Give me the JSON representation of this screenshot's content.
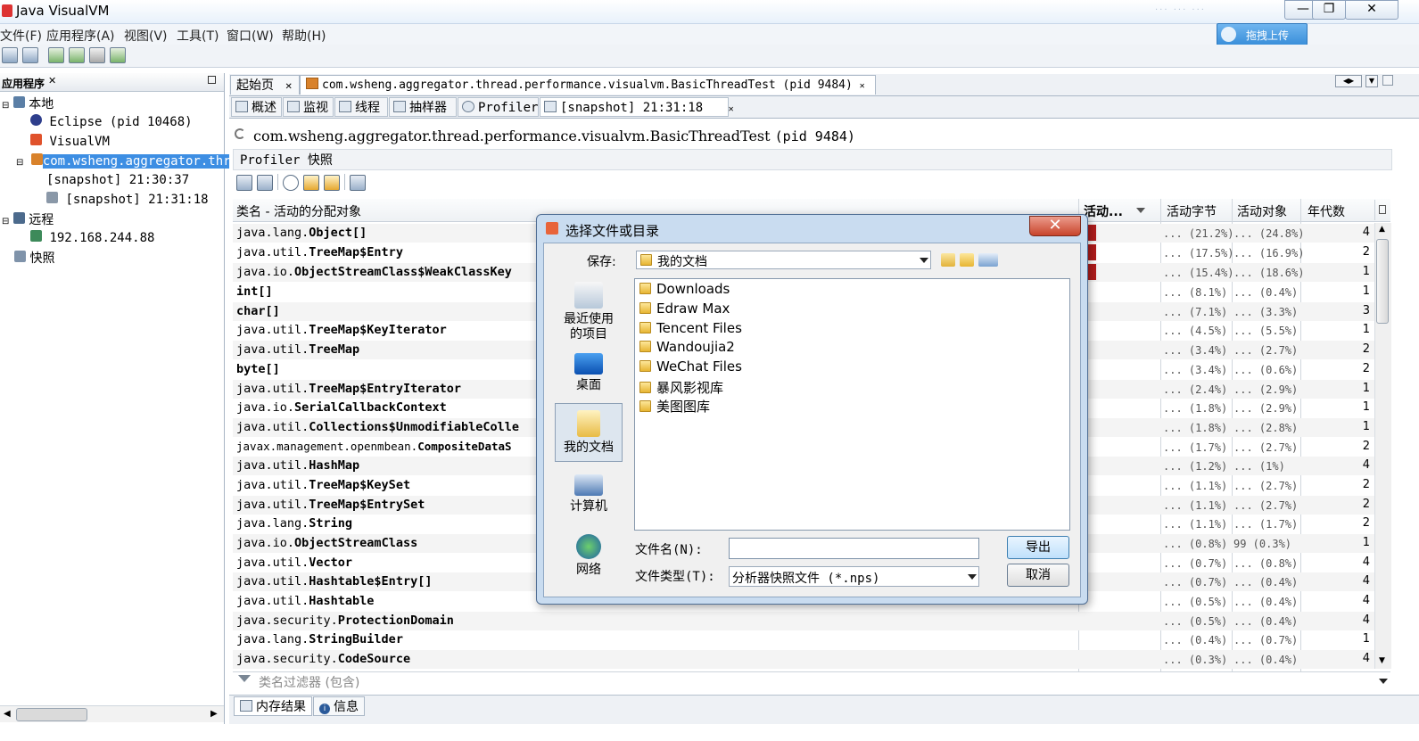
{
  "window": {
    "title": "Java VisualVM",
    "ghost_text": "···  ···  ···",
    "minimize": "—",
    "restore": "❐",
    "close": "✕"
  },
  "menu": [
    "文件(F)",
    "应用程序(A)",
    "视图(V)",
    "工具(T)",
    "窗口(W)",
    "帮助(H)"
  ],
  "upload_button": "拖拽上传",
  "left_panel": {
    "header": "应用程序",
    "tree": [
      {
        "label": "本地"
      },
      {
        "label": "Eclipse (pid 10468)"
      },
      {
        "label": "VisualVM"
      },
      {
        "label": "com.wsheng.aggregator.thr"
      },
      {
        "label": "[snapshot] 21:30:37"
      },
      {
        "label": "[snapshot] 21:31:18"
      },
      {
        "label": "远程"
      },
      {
        "label": "192.168.244.88"
      },
      {
        "label": "快照"
      }
    ]
  },
  "doc_tabs": [
    {
      "label": "起始页"
    },
    {
      "label": "com.wsheng.aggregator.thread.performance.visualvm.BasicThreadTest (pid 9484)"
    }
  ],
  "sub_tabs": [
    "概述",
    "监视",
    "线程",
    "抽样器",
    "Profiler",
    "[snapshot] 21:31:18"
  ],
  "content": {
    "process_title": "com.wsheng.aggregator.thread.performance.visualvm.BasicThreadTest",
    "process_pid": "(pid 9484)",
    "subtitle": "Profiler 快照"
  },
  "table": {
    "headers": [
      "类名 - 活动的分配对象",
      "活动...",
      "活动字节",
      "活动对象",
      "年代数"
    ],
    "rows": [
      {
        "pkg": "java.lang.",
        "cls": "Object[]",
        "bytes": "... (21.2%)",
        "objs": "... (24.8%)",
        "gen": "4"
      },
      {
        "pkg": "java.util.",
        "cls": "TreeMap$Entry",
        "bytes": "... (17.5%)",
        "objs": "... (16.9%)",
        "gen": "2"
      },
      {
        "pkg": "java.io.",
        "cls": "ObjectStreamClass$WeakClassKey",
        "bytes": "... (15.4%)",
        "objs": "... (18.6%)",
        "gen": "1"
      },
      {
        "pkg": "",
        "cls": "int[]",
        "bytes": "... (8.1%)",
        "objs": "... (0.4%)",
        "gen": "1"
      },
      {
        "pkg": "",
        "cls": "char[]",
        "bytes": "... (7.1%)",
        "objs": "... (3.3%)",
        "gen": "3"
      },
      {
        "pkg": "java.util.",
        "cls": "TreeMap$KeyIterator",
        "bytes": "... (4.5%)",
        "objs": "... (5.5%)",
        "gen": "1"
      },
      {
        "pkg": "java.util.",
        "cls": "TreeMap",
        "bytes": "... (3.4%)",
        "objs": "... (2.7%)",
        "gen": "2"
      },
      {
        "pkg": "",
        "cls": "byte[]",
        "bytes": "... (3.4%)",
        "objs": "... (0.6%)",
        "gen": "2"
      },
      {
        "pkg": "java.util.",
        "cls": "TreeMap$EntryIterator",
        "bytes": "... (2.4%)",
        "objs": "... (2.9%)",
        "gen": "1"
      },
      {
        "pkg": "java.io.",
        "cls": "SerialCallbackContext",
        "bytes": "... (1.8%)",
        "objs": "... (2.9%)",
        "gen": "1"
      },
      {
        "pkg": "java.util.",
        "cls": "Collections$UnmodifiableColle",
        "bytes": "... (1.8%)",
        "objs": "... (2.8%)",
        "gen": "1"
      },
      {
        "pkg": "javax.management.openmbean.",
        "cls": "CompositeDataS",
        "bytes": "... (1.7%)",
        "objs": "... (2.7%)",
        "gen": "2"
      },
      {
        "pkg": "java.util.",
        "cls": "HashMap",
        "bytes": "... (1.2%)",
        "objs": "...   (1%)",
        "gen": "4"
      },
      {
        "pkg": "java.util.",
        "cls": "TreeMap$KeySet",
        "bytes": "... (1.1%)",
        "objs": "... (2.7%)",
        "gen": "2"
      },
      {
        "pkg": "java.util.",
        "cls": "TreeMap$EntrySet",
        "bytes": "... (1.1%)",
        "objs": "... (2.7%)",
        "gen": "2"
      },
      {
        "pkg": "java.lang.",
        "cls": "String",
        "bytes": "... (1.1%)",
        "objs": "... (1.7%)",
        "gen": "2"
      },
      {
        "pkg": "java.io.",
        "cls": "ObjectStreamClass",
        "bytes": "... (0.8%)",
        "objs": "99  (0.3%)",
        "gen": "1"
      },
      {
        "pkg": "java.util.",
        "cls": "Vector",
        "bytes": "... (0.7%)",
        "objs": "... (0.8%)",
        "gen": "4"
      },
      {
        "pkg": "java.util.",
        "cls": "Hashtable$Entry[]",
        "bytes": "... (0.7%)",
        "objs": "... (0.4%)",
        "gen": "4"
      },
      {
        "pkg": "java.util.",
        "cls": "Hashtable",
        "bytes": "... (0.5%)",
        "objs": "... (0.4%)",
        "gen": "4"
      },
      {
        "pkg": "java.security.",
        "cls": "ProtectionDomain",
        "bytes": "... (0.5%)",
        "objs": "... (0.4%)",
        "gen": "4"
      },
      {
        "pkg": "java.lang.",
        "cls": "StringBuilder",
        "bytes": "... (0.4%)",
        "objs": "... (0.7%)",
        "gen": "1"
      },
      {
        "pkg": "java.security.",
        "cls": "CodeSource",
        "bytes": "... (0.3%)",
        "objs": "... (0.4%)",
        "gen": "4"
      }
    ],
    "filter_placeholder": "类名过滤器 (包含)"
  },
  "bottom_tabs": [
    "内存结果",
    "信息"
  ],
  "dialog": {
    "title": "选择文件或目录",
    "save_label": "保存:",
    "current_dir": "我的文档",
    "places": [
      "最近使用\n的项目",
      "桌面",
      "我的文档",
      "计算机",
      "网络"
    ],
    "places_lines": [
      [
        "最近使用",
        "的项目"
      ],
      [
        "桌面"
      ],
      [
        "我的文档"
      ],
      [
        "计算机"
      ],
      [
        "网络"
      ]
    ],
    "files": [
      "Downloads",
      "Edraw Max",
      "Tencent Files",
      "Wandoujia2",
      "WeChat Files",
      "暴风影视库",
      "美图图库"
    ],
    "filename_label": "文件名(N):",
    "filename_value": "",
    "filetype_label": "文件类型(T):",
    "filetype_value": "分析器快照文件 (*.nps)",
    "export_button": "导出",
    "cancel_button": "取消",
    "close_glyph": "✕"
  },
  "colors": {
    "selection": "#3d8ee3",
    "bar": "#b01c1c",
    "dialog_frame": "#c9dcf0"
  }
}
